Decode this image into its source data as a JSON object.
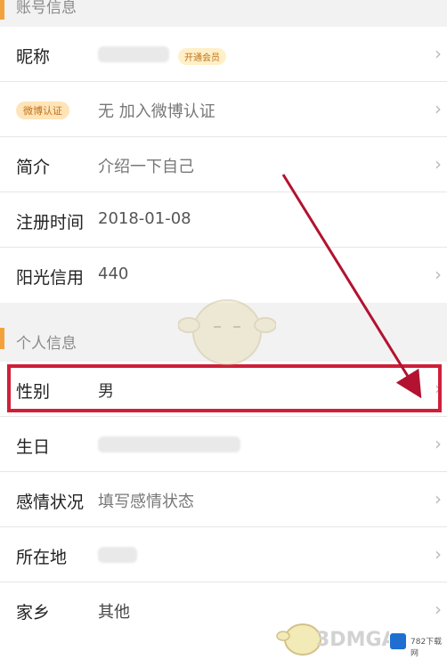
{
  "account_section": {
    "title": "账号信息"
  },
  "nickname_row": {
    "label": "昵称",
    "badge": "开通会员"
  },
  "verify_row": {
    "badge": "微博认证",
    "value": "无 加入微博认证"
  },
  "bio_row": {
    "label": "简介",
    "value": "介绍一下自己"
  },
  "register_row": {
    "label": "注册时间",
    "value": "2018-01-08"
  },
  "credit_row": {
    "label": "阳光信用",
    "value": "440"
  },
  "personal_section": {
    "title": "个人信息"
  },
  "gender_row": {
    "label": "性别",
    "value": "男"
  },
  "birthday_row": {
    "label": "生日"
  },
  "relationship_row": {
    "label": "感情状况",
    "value": "填写感情状态"
  },
  "location_row": {
    "label": "所在地"
  },
  "hometown_row": {
    "label": "家乡",
    "value": "其他"
  },
  "watermark": {
    "brand": "3DMGAME",
    "site": "782下载网"
  },
  "chevron": "›",
  "colors": {
    "accent": "#f2a23a",
    "highlight": "#cf1f39",
    "arrow": "#b31230"
  }
}
